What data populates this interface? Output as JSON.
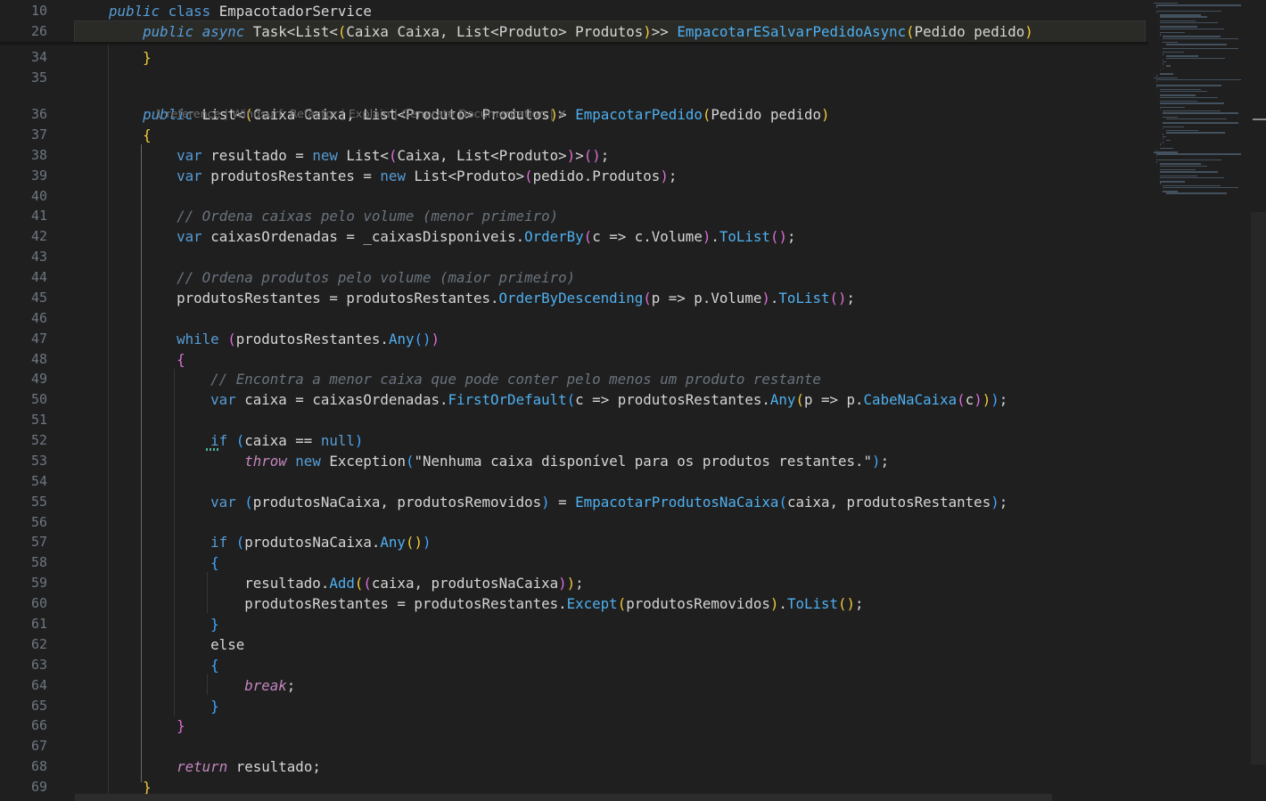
{
  "editor": {
    "sticky_lines": [
      {
        "num": "10",
        "segments": [
          {
            "t": "    ",
            "c": ""
          },
          {
            "t": "public",
            "c": "kwi"
          },
          {
            "t": " ",
            "c": ""
          },
          {
            "t": "class",
            "c": "kw"
          },
          {
            "t": " EmpacotadorService",
            "c": ""
          }
        ]
      },
      {
        "num": "26",
        "segments": [
          {
            "t": "        ",
            "c": ""
          },
          {
            "t": "public",
            "c": "kwi"
          },
          {
            "t": " ",
            "c": ""
          },
          {
            "t": "async",
            "c": "kwi"
          },
          {
            "t": " Task<List<",
            "c": ""
          },
          {
            "t": "(",
            "c": "p1"
          },
          {
            "t": "Caixa Caixa, List<Produto> Produtos",
            "c": ""
          },
          {
            "t": ")",
            "c": "p1"
          },
          {
            "t": ">> ",
            "c": ""
          },
          {
            "t": "EmpacotarESalvarPedidoAsync",
            "c": "fn"
          },
          {
            "t": "(",
            "c": "p1"
          },
          {
            "t": "Pedido pedido",
            "c": ""
          },
          {
            "t": ")",
            "c": "p1"
          }
        ]
      }
    ],
    "lines": [
      {
        "num": "34",
        "segments": [
          {
            "t": "        ",
            "c": ""
          },
          {
            "t": "}",
            "c": "p1"
          }
        ]
      },
      {
        "num": "35",
        "segments": []
      },
      {
        "num": "36",
        "segments": [
          {
            "t": "        ",
            "c": ""
          },
          {
            "t": "public",
            "c": "kwi"
          },
          {
            "t": " List<",
            "c": ""
          },
          {
            "t": "(",
            "c": "p1"
          },
          {
            "t": "Caixa Caixa, List<Produto> Produtos",
            "c": ""
          },
          {
            "t": ")",
            "c": "p1"
          },
          {
            "t": "> ",
            "c": ""
          },
          {
            "t": "EmpacotarPedido",
            "c": "fn"
          },
          {
            "t": "(",
            "c": "p1"
          },
          {
            "t": "Pedido pedido",
            "c": ""
          },
          {
            "t": ")",
            "c": "p1"
          }
        ]
      },
      {
        "num": "37",
        "segments": [
          {
            "t": "        ",
            "c": ""
          },
          {
            "t": "{",
            "c": "p1"
          }
        ]
      },
      {
        "num": "38",
        "segments": [
          {
            "t": "            ",
            "c": ""
          },
          {
            "t": "var",
            "c": "kw"
          },
          {
            "t": " resultado = ",
            "c": ""
          },
          {
            "t": "new",
            "c": "kw"
          },
          {
            "t": " List<",
            "c": ""
          },
          {
            "t": "(",
            "c": "p2"
          },
          {
            "t": "Caixa, List<Produto>",
            "c": ""
          },
          {
            "t": ")",
            "c": "p2"
          },
          {
            "t": ">",
            "c": ""
          },
          {
            "t": "()",
            "c": "p2"
          },
          {
            "t": ";",
            "c": ""
          }
        ]
      },
      {
        "num": "39",
        "segments": [
          {
            "t": "            ",
            "c": ""
          },
          {
            "t": "var",
            "c": "kw"
          },
          {
            "t": " produtosRestantes = ",
            "c": ""
          },
          {
            "t": "new",
            "c": "kw"
          },
          {
            "t": " List<Produto>",
            "c": ""
          },
          {
            "t": "(",
            "c": "p2"
          },
          {
            "t": "pedido.Produtos",
            "c": ""
          },
          {
            "t": ")",
            "c": "p2"
          },
          {
            "t": ";",
            "c": ""
          }
        ]
      },
      {
        "num": "40",
        "segments": []
      },
      {
        "num": "41",
        "segments": [
          {
            "t": "            ",
            "c": ""
          },
          {
            "t": "// Ordena caixas pelo volume (menor primeiro)",
            "c": "cm"
          }
        ]
      },
      {
        "num": "42",
        "segments": [
          {
            "t": "            ",
            "c": ""
          },
          {
            "t": "var",
            "c": "kw"
          },
          {
            "t": " caixasOrdenadas = _caixasDisponiveis.",
            "c": ""
          },
          {
            "t": "OrderBy",
            "c": "fn"
          },
          {
            "t": "(",
            "c": "p2"
          },
          {
            "t": "c => c.Volume",
            "c": ""
          },
          {
            "t": ")",
            "c": "p2"
          },
          {
            "t": ".",
            "c": ""
          },
          {
            "t": "ToList",
            "c": "fn"
          },
          {
            "t": "()",
            "c": "p2"
          },
          {
            "t": ";",
            "c": ""
          }
        ]
      },
      {
        "num": "43",
        "segments": []
      },
      {
        "num": "44",
        "segments": [
          {
            "t": "            ",
            "c": ""
          },
          {
            "t": "// Ordena produtos pelo volume (maior primeiro)",
            "c": "cm"
          }
        ]
      },
      {
        "num": "45",
        "segments": [
          {
            "t": "            ",
            "c": ""
          },
          {
            "t": "produtosRestantes = produtosRestantes.",
            "c": ""
          },
          {
            "t": "OrderByDescending",
            "c": "fn"
          },
          {
            "t": "(",
            "c": "p2"
          },
          {
            "t": "p => p.Volume",
            "c": ""
          },
          {
            "t": ")",
            "c": "p2"
          },
          {
            "t": ".",
            "c": ""
          },
          {
            "t": "ToList",
            "c": "fn"
          },
          {
            "t": "()",
            "c": "p2"
          },
          {
            "t": ";",
            "c": ""
          }
        ]
      },
      {
        "num": "46",
        "segments": []
      },
      {
        "num": "47",
        "segments": [
          {
            "t": "            ",
            "c": ""
          },
          {
            "t": "while",
            "c": "kw"
          },
          {
            "t": " ",
            "c": ""
          },
          {
            "t": "(",
            "c": "p2"
          },
          {
            "t": "produtosRestantes.",
            "c": ""
          },
          {
            "t": "Any",
            "c": "fn"
          },
          {
            "t": "()",
            "c": "p3"
          },
          {
            "t": ")",
            "c": "p2"
          }
        ]
      },
      {
        "num": "48",
        "segments": [
          {
            "t": "            ",
            "c": ""
          },
          {
            "t": "{",
            "c": "p2"
          }
        ]
      },
      {
        "num": "49",
        "segments": [
          {
            "t": "                ",
            "c": ""
          },
          {
            "t": "// Encontra a menor caixa que pode conter pelo menos um produto restante",
            "c": "cm"
          }
        ]
      },
      {
        "num": "50",
        "segments": [
          {
            "t": "                ",
            "c": ""
          },
          {
            "t": "var",
            "c": "kw"
          },
          {
            "t": " caixa = caixasOrdenadas.",
            "c": ""
          },
          {
            "t": "FirstOrDefault",
            "c": "fn"
          },
          {
            "t": "(",
            "c": "p3"
          },
          {
            "t": "c => produtosRestantes.",
            "c": ""
          },
          {
            "t": "Any",
            "c": "fn"
          },
          {
            "t": "(",
            "c": "p1"
          },
          {
            "t": "p => p.",
            "c": ""
          },
          {
            "t": "CabeNaCaixa",
            "c": "fn"
          },
          {
            "t": "(",
            "c": "p2"
          },
          {
            "t": "c",
            "c": ""
          },
          {
            "t": ")",
            "c": "p2"
          },
          {
            "t": ")",
            "c": "p1"
          },
          {
            "t": ")",
            "c": "p3"
          },
          {
            "t": ";",
            "c": ""
          }
        ]
      },
      {
        "num": "51",
        "segments": []
      },
      {
        "num": "52",
        "segments": [
          {
            "t": "                ",
            "c": ""
          },
          {
            "t": "if",
            "c": "kw"
          },
          {
            "t": " ",
            "c": ""
          },
          {
            "t": "(",
            "c": "p3"
          },
          {
            "t": "caixa == ",
            "c": ""
          },
          {
            "t": "null",
            "c": "kw"
          },
          {
            "t": ")",
            "c": "p3"
          }
        ]
      },
      {
        "num": "53",
        "segments": [
          {
            "t": "                    ",
            "c": ""
          },
          {
            "t": "throw",
            "c": "ctl"
          },
          {
            "t": " ",
            "c": ""
          },
          {
            "t": "new",
            "c": "kw"
          },
          {
            "t": " Exception",
            "c": ""
          },
          {
            "t": "(",
            "c": "p3"
          },
          {
            "t": "\"Nenhuma caixa disponível para os produtos restantes.\"",
            "c": "str"
          },
          {
            "t": ")",
            "c": "p3"
          },
          {
            "t": ";",
            "c": ""
          }
        ]
      },
      {
        "num": "54",
        "segments": []
      },
      {
        "num": "55",
        "segments": [
          {
            "t": "                ",
            "c": ""
          },
          {
            "t": "var",
            "c": "kw"
          },
          {
            "t": " ",
            "c": ""
          },
          {
            "t": "(",
            "c": "p3"
          },
          {
            "t": "produtosNaCaixa, produtosRemovidos",
            "c": ""
          },
          {
            "t": ")",
            "c": "p3"
          },
          {
            "t": " = ",
            "c": ""
          },
          {
            "t": "EmpacotarProdutosNaCaixa",
            "c": "fn"
          },
          {
            "t": "(",
            "c": "p3"
          },
          {
            "t": "caixa, produtosRestantes",
            "c": ""
          },
          {
            "t": ")",
            "c": "p3"
          },
          {
            "t": ";",
            "c": ""
          }
        ]
      },
      {
        "num": "56",
        "segments": []
      },
      {
        "num": "57",
        "segments": [
          {
            "t": "                ",
            "c": ""
          },
          {
            "t": "if",
            "c": "kw"
          },
          {
            "t": " ",
            "c": ""
          },
          {
            "t": "(",
            "c": "p3"
          },
          {
            "t": "produtosNaCaixa.",
            "c": ""
          },
          {
            "t": "Any",
            "c": "fn"
          },
          {
            "t": "()",
            "c": "p1"
          },
          {
            "t": ")",
            "c": "p3"
          }
        ]
      },
      {
        "num": "58",
        "segments": [
          {
            "t": "                ",
            "c": ""
          },
          {
            "t": "{",
            "c": "p3"
          }
        ]
      },
      {
        "num": "59",
        "segments": [
          {
            "t": "                    ",
            "c": ""
          },
          {
            "t": "resultado.",
            "c": ""
          },
          {
            "t": "Add",
            "c": "fn"
          },
          {
            "t": "(",
            "c": "p1"
          },
          {
            "t": "(",
            "c": "p2"
          },
          {
            "t": "caixa, produtosNaCaixa",
            "c": ""
          },
          {
            "t": ")",
            "c": "p2"
          },
          {
            "t": ")",
            "c": "p1"
          },
          {
            "t": ";",
            "c": ""
          }
        ]
      },
      {
        "num": "60",
        "segments": [
          {
            "t": "                    ",
            "c": ""
          },
          {
            "t": "produtosRestantes = produtosRestantes.",
            "c": ""
          },
          {
            "t": "Except",
            "c": "fn"
          },
          {
            "t": "(",
            "c": "p1"
          },
          {
            "t": "produtosRemovidos",
            "c": ""
          },
          {
            "t": ")",
            "c": "p1"
          },
          {
            "t": ".",
            "c": ""
          },
          {
            "t": "ToList",
            "c": "fn"
          },
          {
            "t": "()",
            "c": "p1"
          },
          {
            "t": ";",
            "c": ""
          }
        ]
      },
      {
        "num": "61",
        "segments": [
          {
            "t": "                ",
            "c": ""
          },
          {
            "t": "}",
            "c": "p3"
          }
        ]
      },
      {
        "num": "62",
        "segments": [
          {
            "t": "                ",
            "c": ""
          },
          {
            "t": "else",
            "c": ""
          }
        ]
      },
      {
        "num": "63",
        "segments": [
          {
            "t": "                ",
            "c": ""
          },
          {
            "t": "{",
            "c": "p3"
          }
        ]
      },
      {
        "num": "64",
        "segments": [
          {
            "t": "                    ",
            "c": ""
          },
          {
            "t": "break",
            "c": "ctl"
          },
          {
            "t": ";",
            "c": ""
          }
        ]
      },
      {
        "num": "65",
        "segments": [
          {
            "t": "                ",
            "c": ""
          },
          {
            "t": "}",
            "c": "p3"
          }
        ]
      },
      {
        "num": "66",
        "segments": [
          {
            "t": "            ",
            "c": ""
          },
          {
            "t": "}",
            "c": "p2"
          }
        ]
      },
      {
        "num": "67",
        "segments": []
      },
      {
        "num": "68",
        "segments": [
          {
            "t": "            ",
            "c": ""
          },
          {
            "t": "return",
            "c": "ctl"
          },
          {
            "t": " resultado;",
            "c": ""
          }
        ]
      },
      {
        "num": "69",
        "segments": [
          {
            "t": "        ",
            "c": ""
          },
          {
            "t": "}",
            "c": "p1"
          }
        ]
      }
    ],
    "codelens": {
      "references": "1 reference",
      "refactor": "Windsurf: Refactor",
      "explain": "Explain",
      "generate_docs": "Generate Documentation",
      "close_glyph": "✕"
    }
  }
}
